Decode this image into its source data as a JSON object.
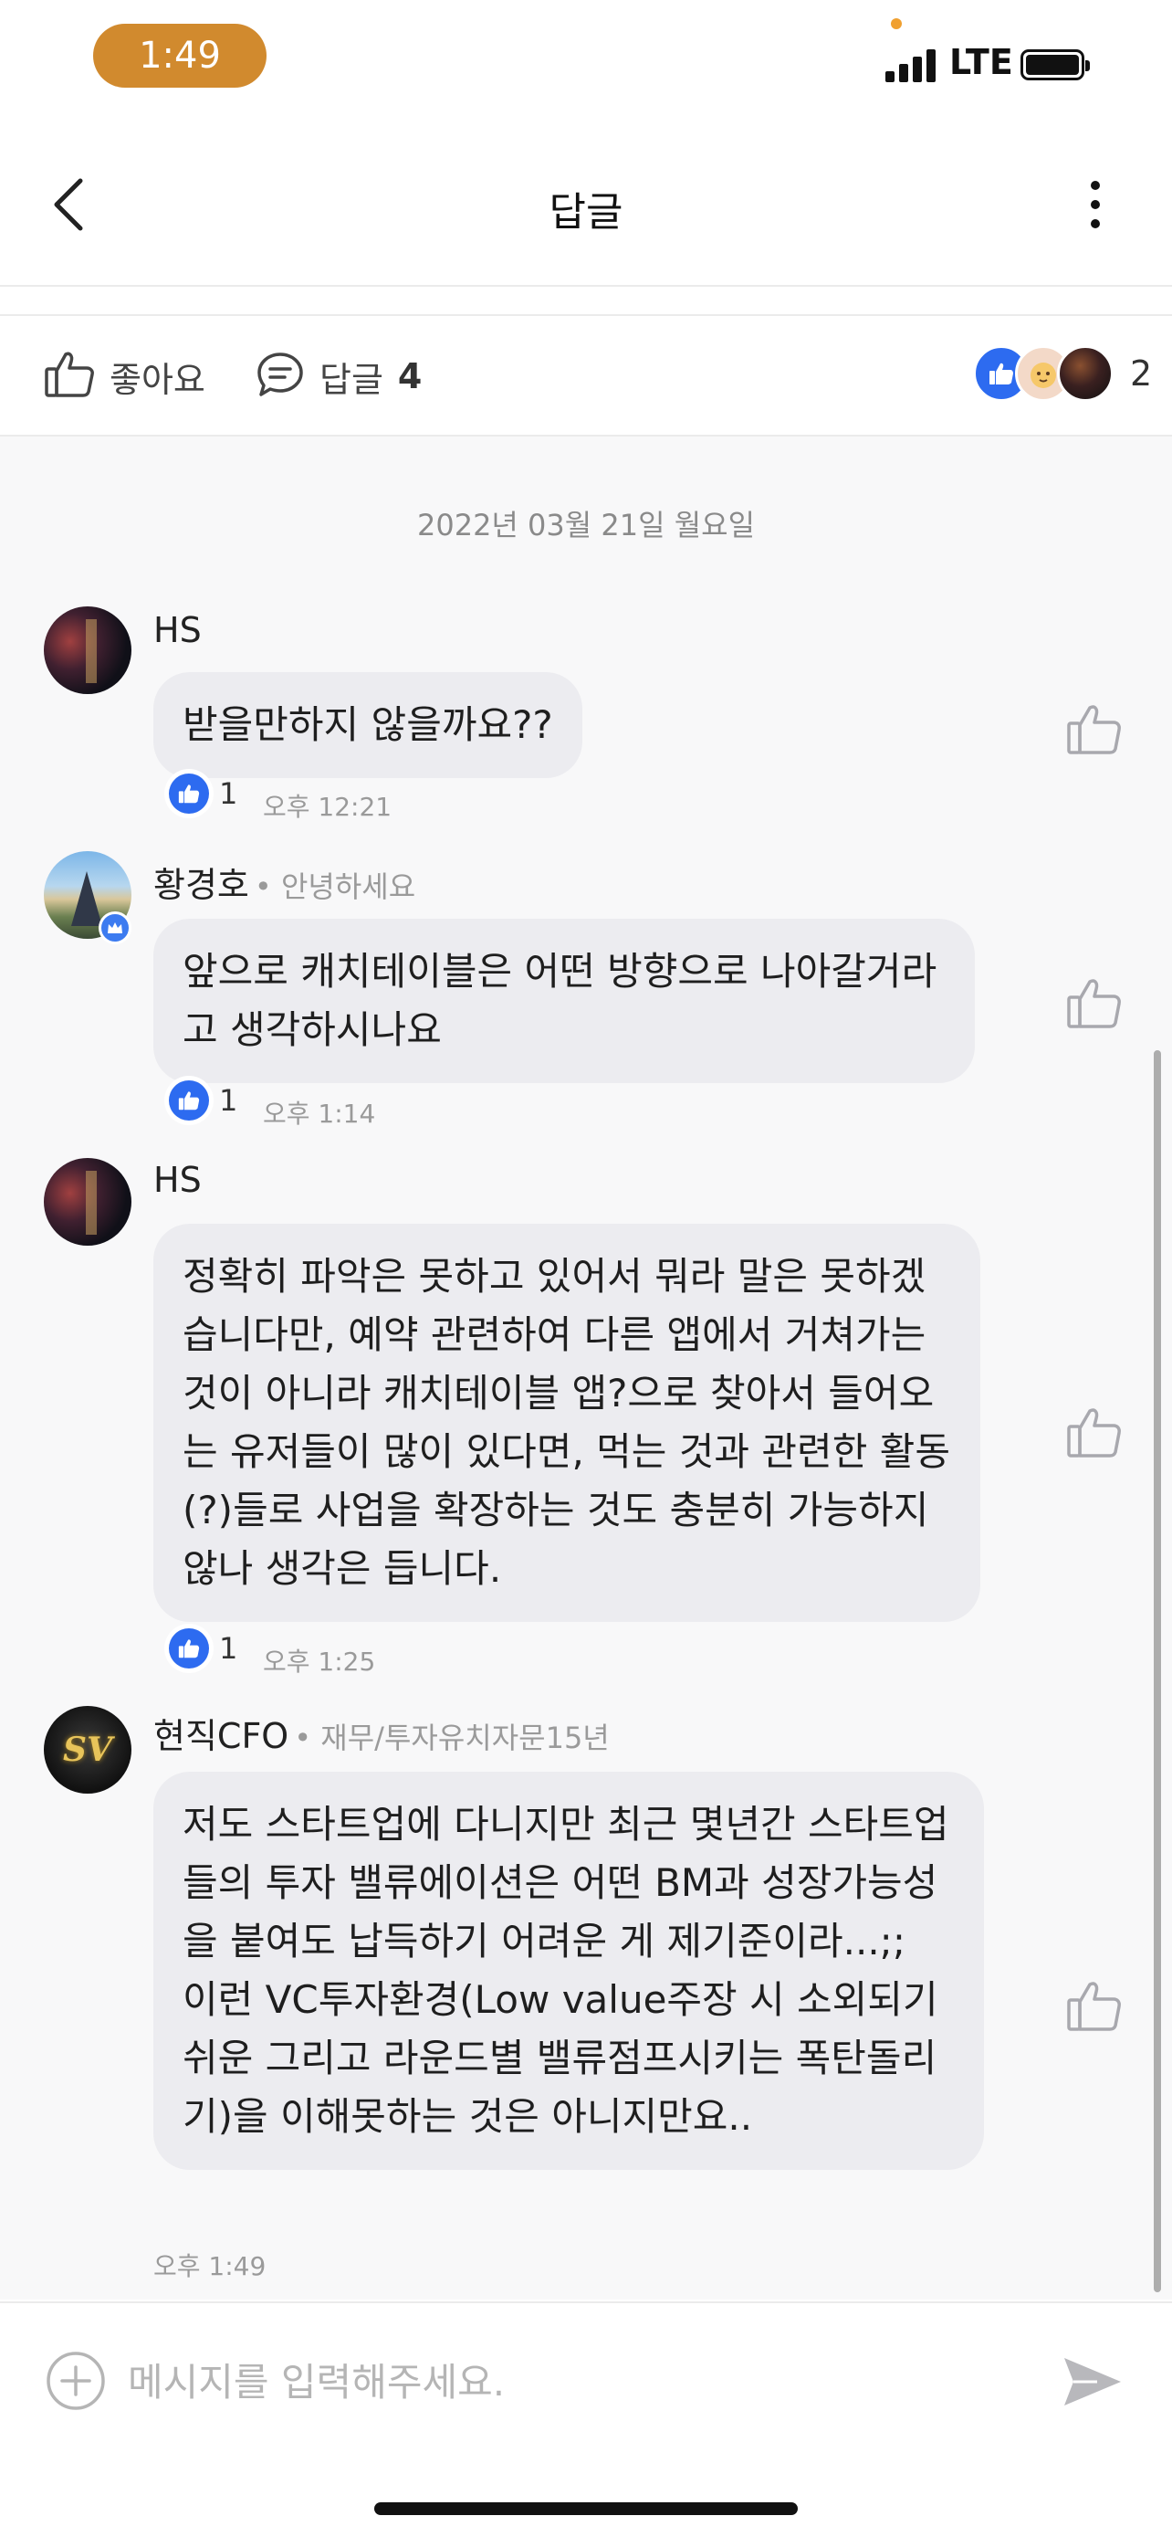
{
  "status_bar": {
    "time": "1:49",
    "network": "LTE",
    "time_pill_color": "#D18A2E"
  },
  "nav": {
    "title": "답글",
    "back_icon": "chevron-left-icon",
    "more_icon": "more-vertical-icon"
  },
  "actions": {
    "like_label": "좋아요",
    "reply_label": "답글",
    "reply_count": "4",
    "reaction_count": "2"
  },
  "thread": {
    "date": "2022년 03월 21일 월요일",
    "messages": [
      {
        "author": "HS",
        "bio": "",
        "text": "받을만하지 않을까요??",
        "likes": "1",
        "time": "오후 12:21"
      },
      {
        "author": "황경호",
        "bio": "• 안녕하세요",
        "text": "앞으로 캐치테이블은 어떤 방향으로 나아갈거라고 생각하시나요",
        "likes": "1",
        "time": "오후 1:14"
      },
      {
        "author": "HS",
        "bio": "",
        "text": "정확히 파악은 못하고 있어서 뭐라 말은 못하겠습니다만, 예약 관련하여 다른 앱에서 거쳐가는 것이 아니라 캐치테이블 앱?으로 찾아서 들어오는 유저들이 많이 있다면, 먹는 것과 관련한 활동(?)들로 사업을 확장하는 것도 충분히 가능하지 않나 생각은 듭니다.",
        "likes": "1",
        "time": "오후 1:25"
      },
      {
        "author": "현직CFO",
        "bio": "• 재무/투자유치자문15년",
        "avatar_text": "SV",
        "text": "저도 스타트업에 다니지만 최근 몇년간 스타트업들의 투자 밸류에이션은 어떤 BM과 성장가능성을 붙여도 납득하기 어려운 게 제기준이라...;;\n이런 VC투자환경(Low value주장 시 소외되기 쉬운 그리고 라운드별 밸류점프시키는 폭탄돌리기)을 이해못하는 것은 아니지만요..",
        "likes": "",
        "time": "오후 1:49"
      }
    ]
  },
  "composer": {
    "placeholder": "메시지를 입력해주세요."
  },
  "colors": {
    "accent": "#2D6BF0",
    "bubble": "#ECECF0",
    "thread_bg": "#F8F8F9"
  }
}
